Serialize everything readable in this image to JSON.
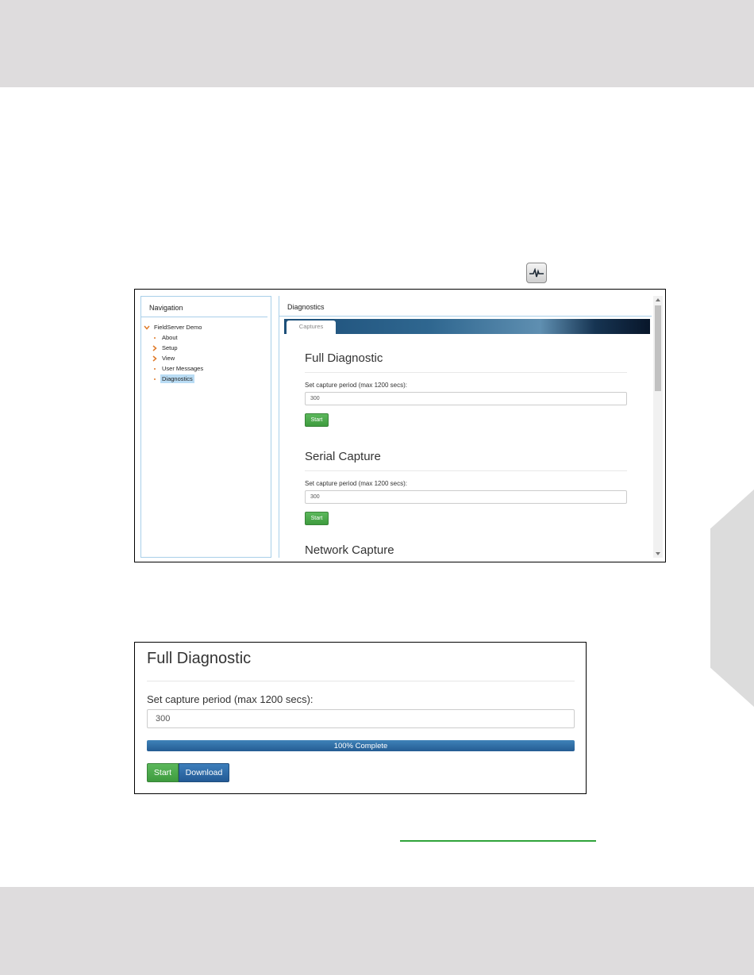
{
  "colors": {
    "band": "#dedcdd",
    "accent_blue": "#2f6790",
    "accent_green": "#4cae4c",
    "nav_border": "#a9cfe9",
    "selected_bg": "#b9dcf4",
    "tree_orange": "#e07a28",
    "link_rule_green": "#2fa33a"
  },
  "toolbar_icon": {
    "icon": "diagnostics-waveform-icon"
  },
  "screenshot1": {
    "navigation": {
      "title": "Navigation",
      "tree": [
        {
          "label": "FieldServer Demo",
          "icon": "chevron-down-icon",
          "level": 0
        },
        {
          "label": "About",
          "icon": "bullet-icon",
          "level": 1
        },
        {
          "label": "Setup",
          "icon": "chevron-right-icon",
          "level": 1
        },
        {
          "label": "View",
          "icon": "chevron-right-icon",
          "level": 1
        },
        {
          "label": "User Messages",
          "icon": "bullet-icon",
          "level": 1
        },
        {
          "label": "Diagnostics",
          "icon": "bullet-icon",
          "level": 1,
          "selected": true
        }
      ]
    },
    "main": {
      "title": "Diagnostics",
      "tab": "Captures",
      "sections": [
        {
          "heading": "Full Diagnostic",
          "label": "Set capture period (max 1200 secs):",
          "value": "300",
          "button": "Start"
        },
        {
          "heading": "Serial Capture",
          "label": "Set capture period (max 1200 secs):",
          "value": "300",
          "button": "Start"
        }
      ],
      "partial_heading": "Network Capture"
    }
  },
  "screenshot2": {
    "heading": "Full Diagnostic",
    "label": "Set capture period (max 1200 secs):",
    "value": "300",
    "progress": {
      "percent": 100,
      "text": "100% Complete"
    },
    "start_button": "Start",
    "download_button": "Download"
  }
}
